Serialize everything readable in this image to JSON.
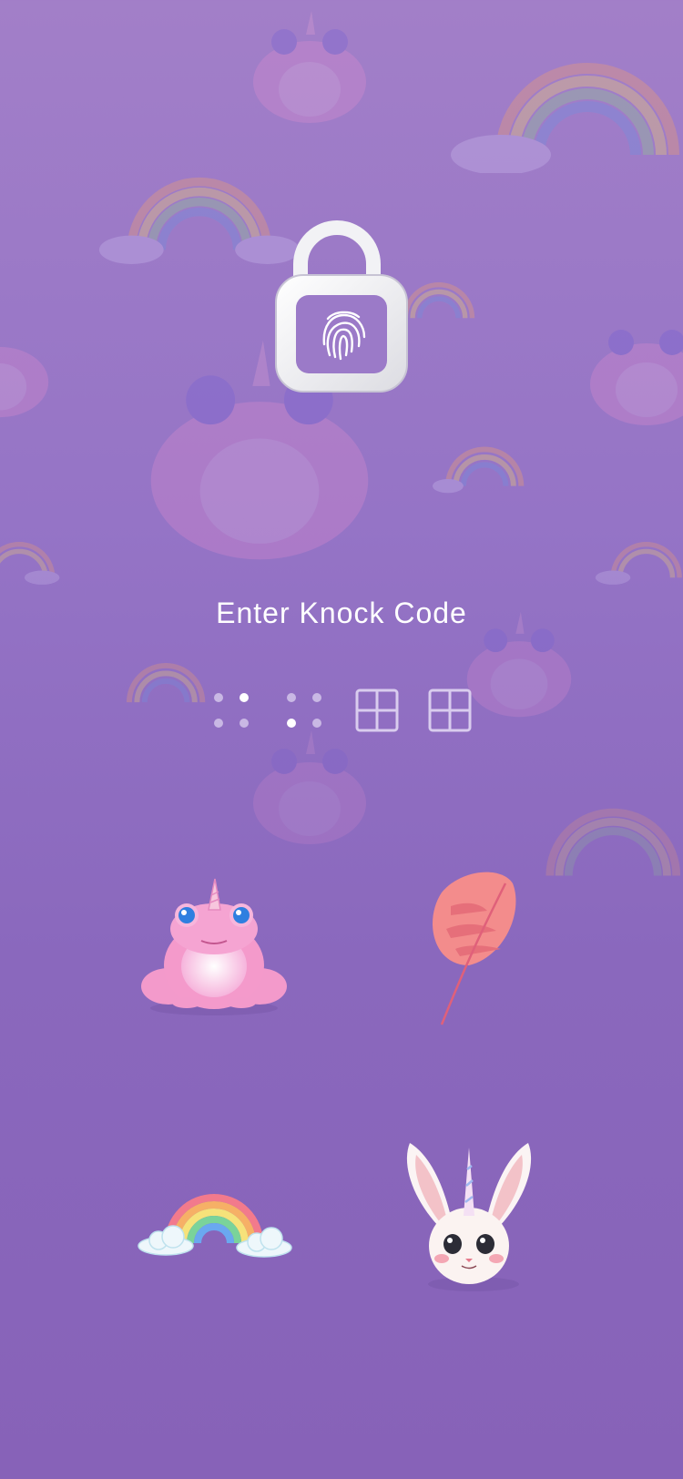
{
  "screen": {
    "prompt": "Enter Knock Code",
    "lock_icon": "unlocked-padlock-fingerprint-icon",
    "code_slots": [
      {
        "slot": 1,
        "state": "entered",
        "icon": "dot-grid-icon"
      },
      {
        "slot": 2,
        "state": "entered",
        "icon": "dot-grid-icon"
      },
      {
        "slot": 3,
        "state": "empty",
        "icon": "quad-grid-icon"
      },
      {
        "slot": 4,
        "state": "empty",
        "icon": "quad-grid-icon"
      }
    ],
    "knock_tiles": [
      {
        "name": "knock-tile-frog",
        "icon": "unicorn-frog-icon"
      },
      {
        "name": "knock-tile-leaf",
        "icon": "pink-leaf-icon"
      },
      {
        "name": "knock-tile-rainbow",
        "icon": "rainbow-cloud-icon"
      },
      {
        "name": "knock-tile-bunny",
        "icon": "unicorn-bunny-icon"
      }
    ]
  },
  "colors": {
    "background_top": "#a27fc8",
    "background_bottom": "#8762b8",
    "lock_white": "#f4f4f6",
    "lock_inner": "#9b7ac8",
    "prompt_text": "#ffffff"
  }
}
